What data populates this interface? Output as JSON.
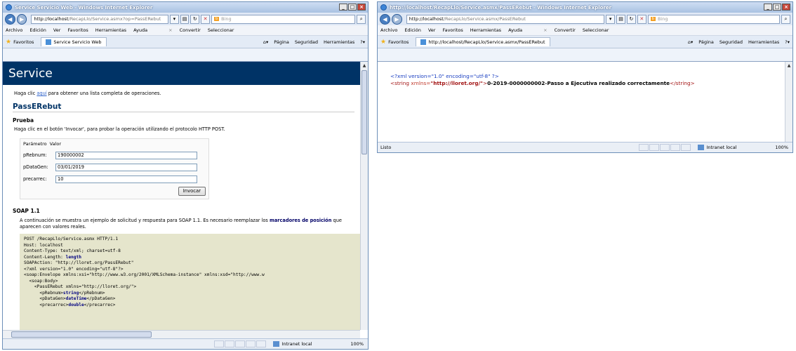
{
  "left": {
    "title": "Service Servicio Web - Windows Internet Explorer",
    "address_host": "http://localhost",
    "address_path": "/RecapLlo/Service.asmx?op=PassERebut",
    "search": "Bing",
    "menu": [
      "Archivo",
      "Edición",
      "Ver",
      "Favoritos",
      "Herramientas",
      "Ayuda"
    ],
    "menu_right": [
      "Convertir",
      "Seleccionar"
    ],
    "favorites_label": "Favoritos",
    "tab_label": "Service Servicio Web",
    "tools": [
      "Página",
      "Seguridad",
      "Herramientas"
    ],
    "page": {
      "header": "Service",
      "intro_pre": "Haga clic ",
      "intro_link": "aquí",
      "intro_post": " para obtener una lista completa de operaciones.",
      "op_name": "PassERebut",
      "test_heading": "Prueba",
      "test_text": "Haga clic en el botón 'Invocar', para probar la operación utilizando el protocolo HTTP POST.",
      "col_param": "Parámetro",
      "col_value": "Valor",
      "params": [
        {
          "name": "pRebnum:",
          "value": "190000002"
        },
        {
          "name": "pDataGen:",
          "value": "03/01/2019"
        },
        {
          "name": "precarrec:",
          "value": "10"
        }
      ],
      "invoke": "Invocar",
      "soap_heading": "SOAP 1.1",
      "soap_text": "A continuación se muestra un ejemplo de solicitud y respuesta para SOAP 1.1. Es necesario reemplazar los ",
      "soap_link": "marcadores de posición",
      "soap_text2": " que aparecen con valores reales.",
      "code_lines": [
        "POST /RecapLlo/Service.asmx HTTP/1.1",
        "Host: localhost",
        "Content-Type: text/xml; charset=utf-8",
        "Content-Length: ",
        "SOAPAction: \"http://lloret.org/PassERebut\"",
        "",
        "<?xml version=\"1.0\" encoding=\"utf-8\"?>",
        "<soap:Envelope xmlns:xsi=\"http://www.w3.org/2001/XMLSchema-instance\" xmlns:xsd=\"http://www.w",
        "  <soap:Body>",
        "    <PassERebut xmlns=\"http://lloret.org/\">",
        "      <pRebnum>",
        "      <pDataGen>",
        "      <precarrec>"
      ],
      "length_kw": "length",
      "rebnum_kw": "string",
      "rebnum_close": "</pRebnum>",
      "datagen_kw": "dateTime",
      "datagen_close": "</pDataGen>",
      "precarrec_kw": "double",
      "precarrec_close": "</precarrec>"
    },
    "status": "",
    "zone": "Intranet local",
    "zoom": "100%"
  },
  "right": {
    "title": "http://localhost/RecapLlo/Service.asmx/PassERebut - Windows Internet Explorer",
    "address_host": "http://localhost",
    "address_path": "/RecapLlo/Service.asmx/PassERebut",
    "search": "Bing",
    "menu": [
      "Archivo",
      "Edición",
      "Ver",
      "Favoritos",
      "Herramientas",
      "Ayuda"
    ],
    "menu_right": [
      "Convertir",
      "Seleccionar"
    ],
    "favorites_label": "Favoritos",
    "tab_label": "http://localhost/RecapLlo/Service.asmx/PassERebut",
    "tools": [
      "Página",
      "Seguridad",
      "Herramientas"
    ],
    "xml_decl": "<?xml version=\"1.0\" encoding=\"utf-8\" ?>",
    "xml_open": "<string ",
    "xml_attr": "xmlns=",
    "xml_attr_val": "\"http://lloret.org/\"",
    "xml_gt": ">",
    "xml_content": "0-2019-0000000002-Passo a Ejecutiva realizado correctamente",
    "xml_close": "</string>",
    "status": "Listo",
    "zone": "Intranet local",
    "zoom": "100%"
  }
}
